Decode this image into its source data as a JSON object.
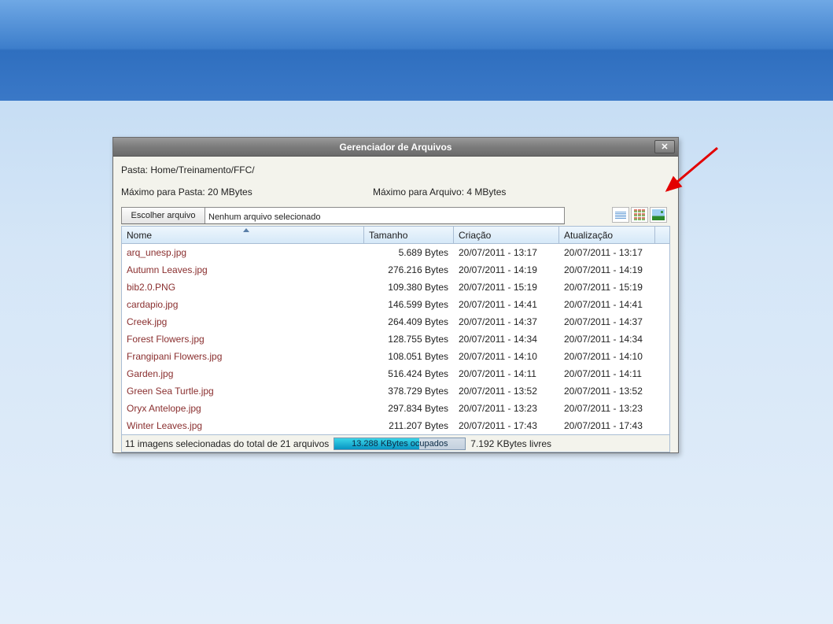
{
  "dialog": {
    "title": "Gerenciador de Arquivos",
    "folder_label": "Pasta:",
    "folder_path": "Home/Treinamento/FFC/",
    "max_folder_label": "Máximo para Pasta: 20 MBytes",
    "max_file_label": "Máximo para Arquivo: 4 MBytes",
    "choose_button": "Escolher arquivo",
    "no_file_selected": "Nenhum arquivo selecionado"
  },
  "columns": {
    "nome": "Nome",
    "tamanho": "Tamanho",
    "criacao": "Criação",
    "atualizacao": "Atualização"
  },
  "files": [
    {
      "nome": "arq_unesp.jpg",
      "tamanho": "5.689 Bytes",
      "criacao": "20/07/2011 - 13:17",
      "atualizacao": "20/07/2011 - 13:17"
    },
    {
      "nome": "Autumn Leaves.jpg",
      "tamanho": "276.216 Bytes",
      "criacao": "20/07/2011 - 14:19",
      "atualizacao": "20/07/2011 - 14:19"
    },
    {
      "nome": "bib2.0.PNG",
      "tamanho": "109.380 Bytes",
      "criacao": "20/07/2011 - 15:19",
      "atualizacao": "20/07/2011 - 15:19"
    },
    {
      "nome": "cardapio.jpg",
      "tamanho": "146.599 Bytes",
      "criacao": "20/07/2011 - 14:41",
      "atualizacao": "20/07/2011 - 14:41"
    },
    {
      "nome": "Creek.jpg",
      "tamanho": "264.409 Bytes",
      "criacao": "20/07/2011 - 14:37",
      "atualizacao": "20/07/2011 - 14:37"
    },
    {
      "nome": "Forest Flowers.jpg",
      "tamanho": "128.755 Bytes",
      "criacao": "20/07/2011 - 14:34",
      "atualizacao": "20/07/2011 - 14:34"
    },
    {
      "nome": "Frangipani Flowers.jpg",
      "tamanho": "108.051 Bytes",
      "criacao": "20/07/2011 - 14:10",
      "atualizacao": "20/07/2011 - 14:10"
    },
    {
      "nome": "Garden.jpg",
      "tamanho": "516.424 Bytes",
      "criacao": "20/07/2011 - 14:11",
      "atualizacao": "20/07/2011 - 14:11"
    },
    {
      "nome": "Green Sea Turtle.jpg",
      "tamanho": "378.729 Bytes",
      "criacao": "20/07/2011 - 13:52",
      "atualizacao": "20/07/2011 - 13:52"
    },
    {
      "nome": "Oryx Antelope.jpg",
      "tamanho": "297.834 Bytes",
      "criacao": "20/07/2011 - 13:23",
      "atualizacao": "20/07/2011 - 13:23"
    },
    {
      "nome": "Winter Leaves.jpg",
      "tamanho": "211.207 Bytes",
      "criacao": "20/07/2011 - 17:43",
      "atualizacao": "20/07/2011 - 17:43"
    }
  ],
  "footer": {
    "selection_text": "11 imagens selecionadas do total de 21 arquivos",
    "used_label": "13.288 KBytes ocupados",
    "used_percent": 65,
    "free_label": "7.192 KBytes livres"
  }
}
